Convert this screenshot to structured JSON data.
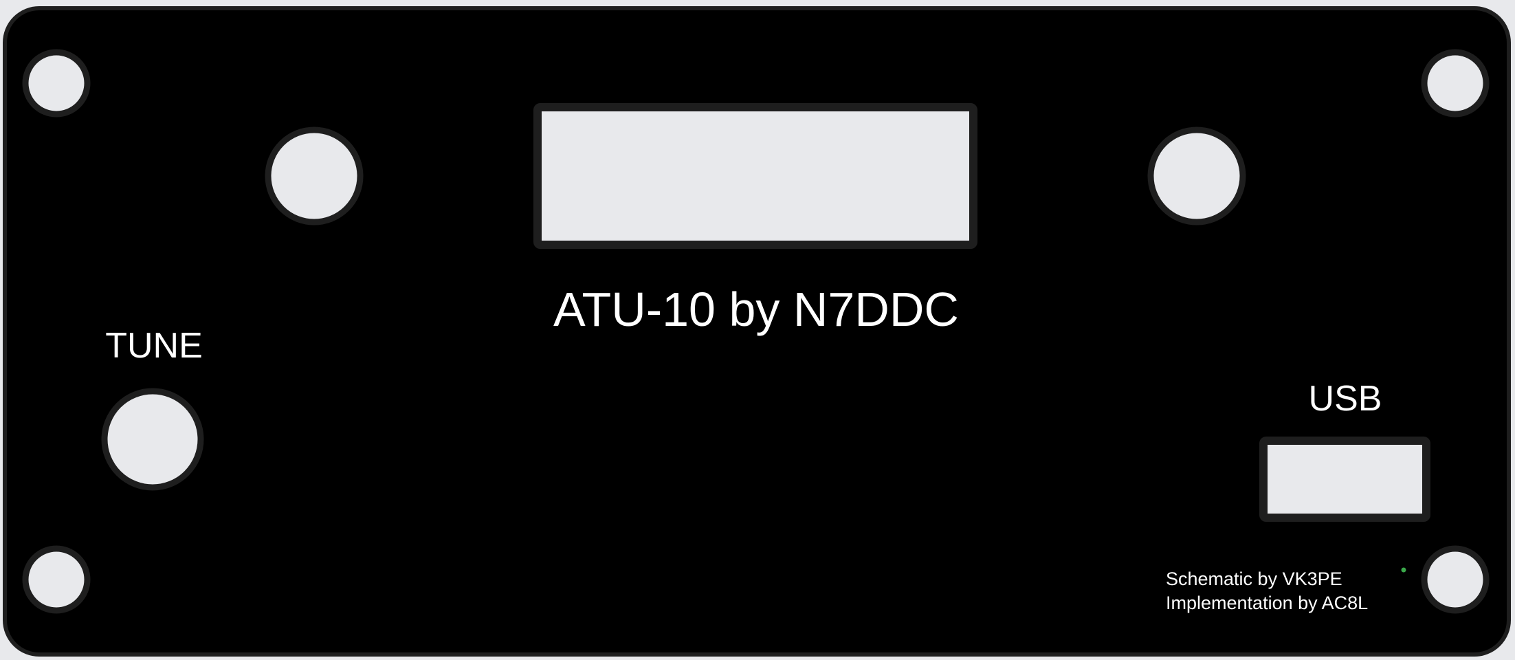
{
  "panel": {
    "title": "ATU-10 by N7DDC",
    "tune_label": "TUNE",
    "usb_label": "USB",
    "credits": {
      "line1": "Schematic by VK3PE",
      "line2": "Implementation by AC8L"
    }
  },
  "colors": {
    "background": "#e8e9ec",
    "panel": "#000000",
    "hole_fill": "#e8e9ec",
    "hole_outline": "#1e1e1e",
    "text": "#ffffff",
    "led": "#3aa84a"
  }
}
